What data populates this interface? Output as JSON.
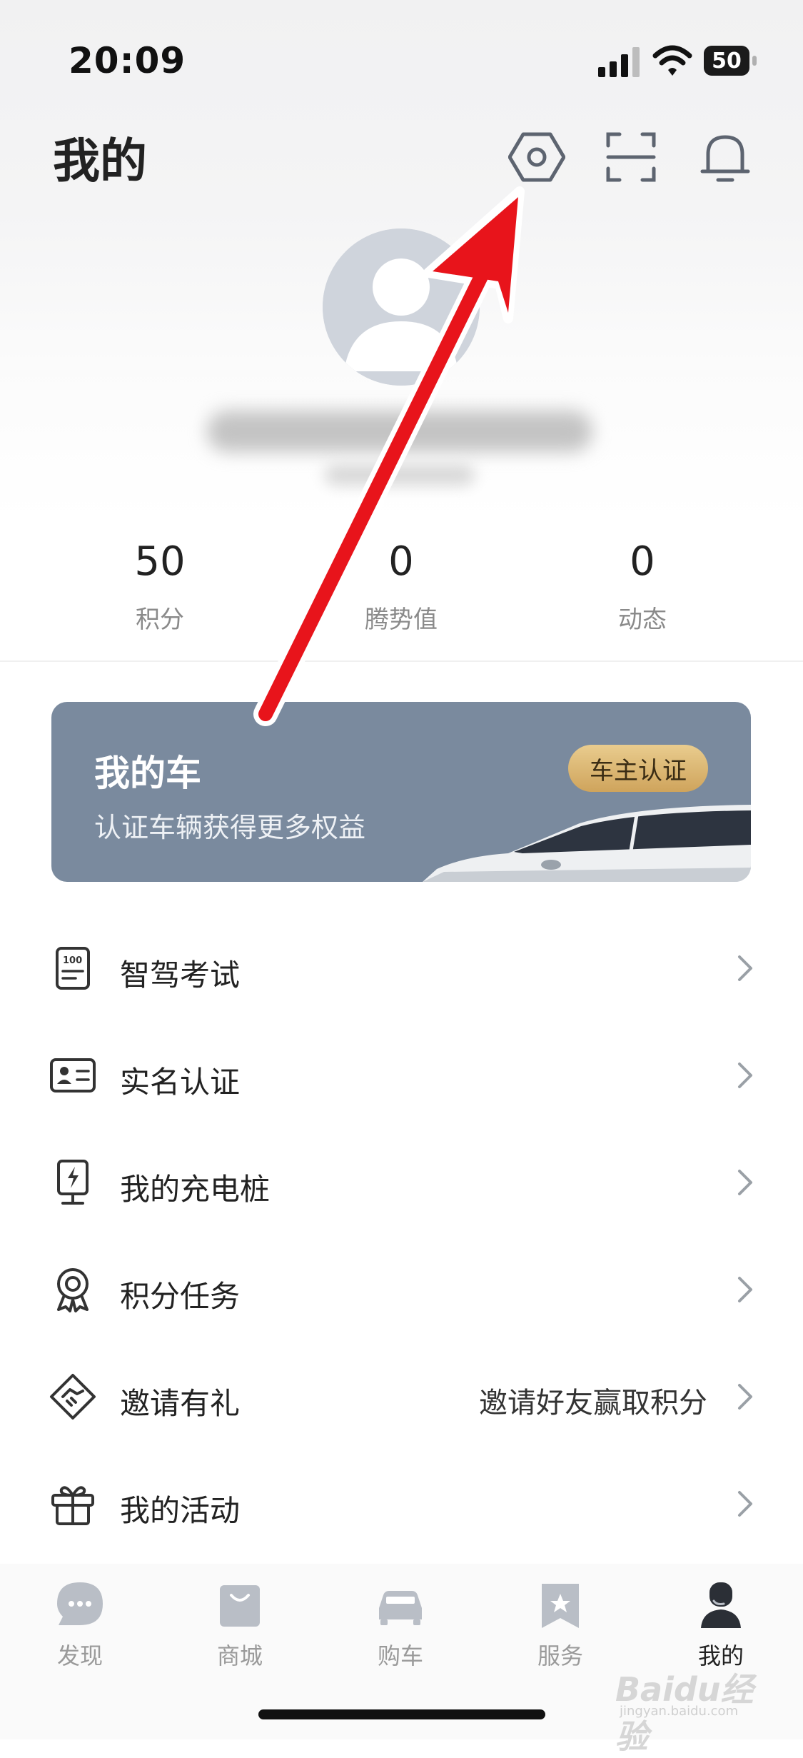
{
  "status_bar": {
    "time": "20:09",
    "battery": "50"
  },
  "header": {
    "title": "我的"
  },
  "stats": [
    {
      "value": "50",
      "label": "积分"
    },
    {
      "value": "0",
      "label": "腾势值"
    },
    {
      "value": "0",
      "label": "动态"
    }
  ],
  "car_card": {
    "title": "我的车",
    "subtitle": "认证车辆获得更多权益",
    "button": "车主认证"
  },
  "menu": [
    {
      "label": "智驾考试",
      "icon": "exam-icon",
      "extra": ""
    },
    {
      "label": "实名认证",
      "icon": "id-card-icon",
      "extra": ""
    },
    {
      "label": "我的充电桩",
      "icon": "charging-pile-icon",
      "extra": ""
    },
    {
      "label": "积分任务",
      "icon": "medal-icon",
      "extra": ""
    },
    {
      "label": "邀请有礼",
      "icon": "handshake-icon",
      "extra": "邀请好友赢取积分"
    },
    {
      "label": "我的活动",
      "icon": "gift-icon",
      "extra": ""
    }
  ],
  "tabbar": [
    {
      "label": "发现",
      "icon": "chat-bubble-icon",
      "active": false
    },
    {
      "label": "商城",
      "icon": "shopping-bag-icon",
      "active": false
    },
    {
      "label": "购车",
      "icon": "car-icon",
      "active": false
    },
    {
      "label": "服务",
      "icon": "bookmark-star-icon",
      "active": false
    },
    {
      "label": "我的",
      "icon": "person-icon",
      "active": true
    }
  ],
  "watermark": {
    "text": "Baidu经验",
    "url": "jingyan.baidu.com"
  },
  "colors": {
    "car_card_bg": "#7a8a9e",
    "owner_button": "#d9b46a",
    "arrow": "#e8141b",
    "icon_gray": "#5d6470"
  }
}
